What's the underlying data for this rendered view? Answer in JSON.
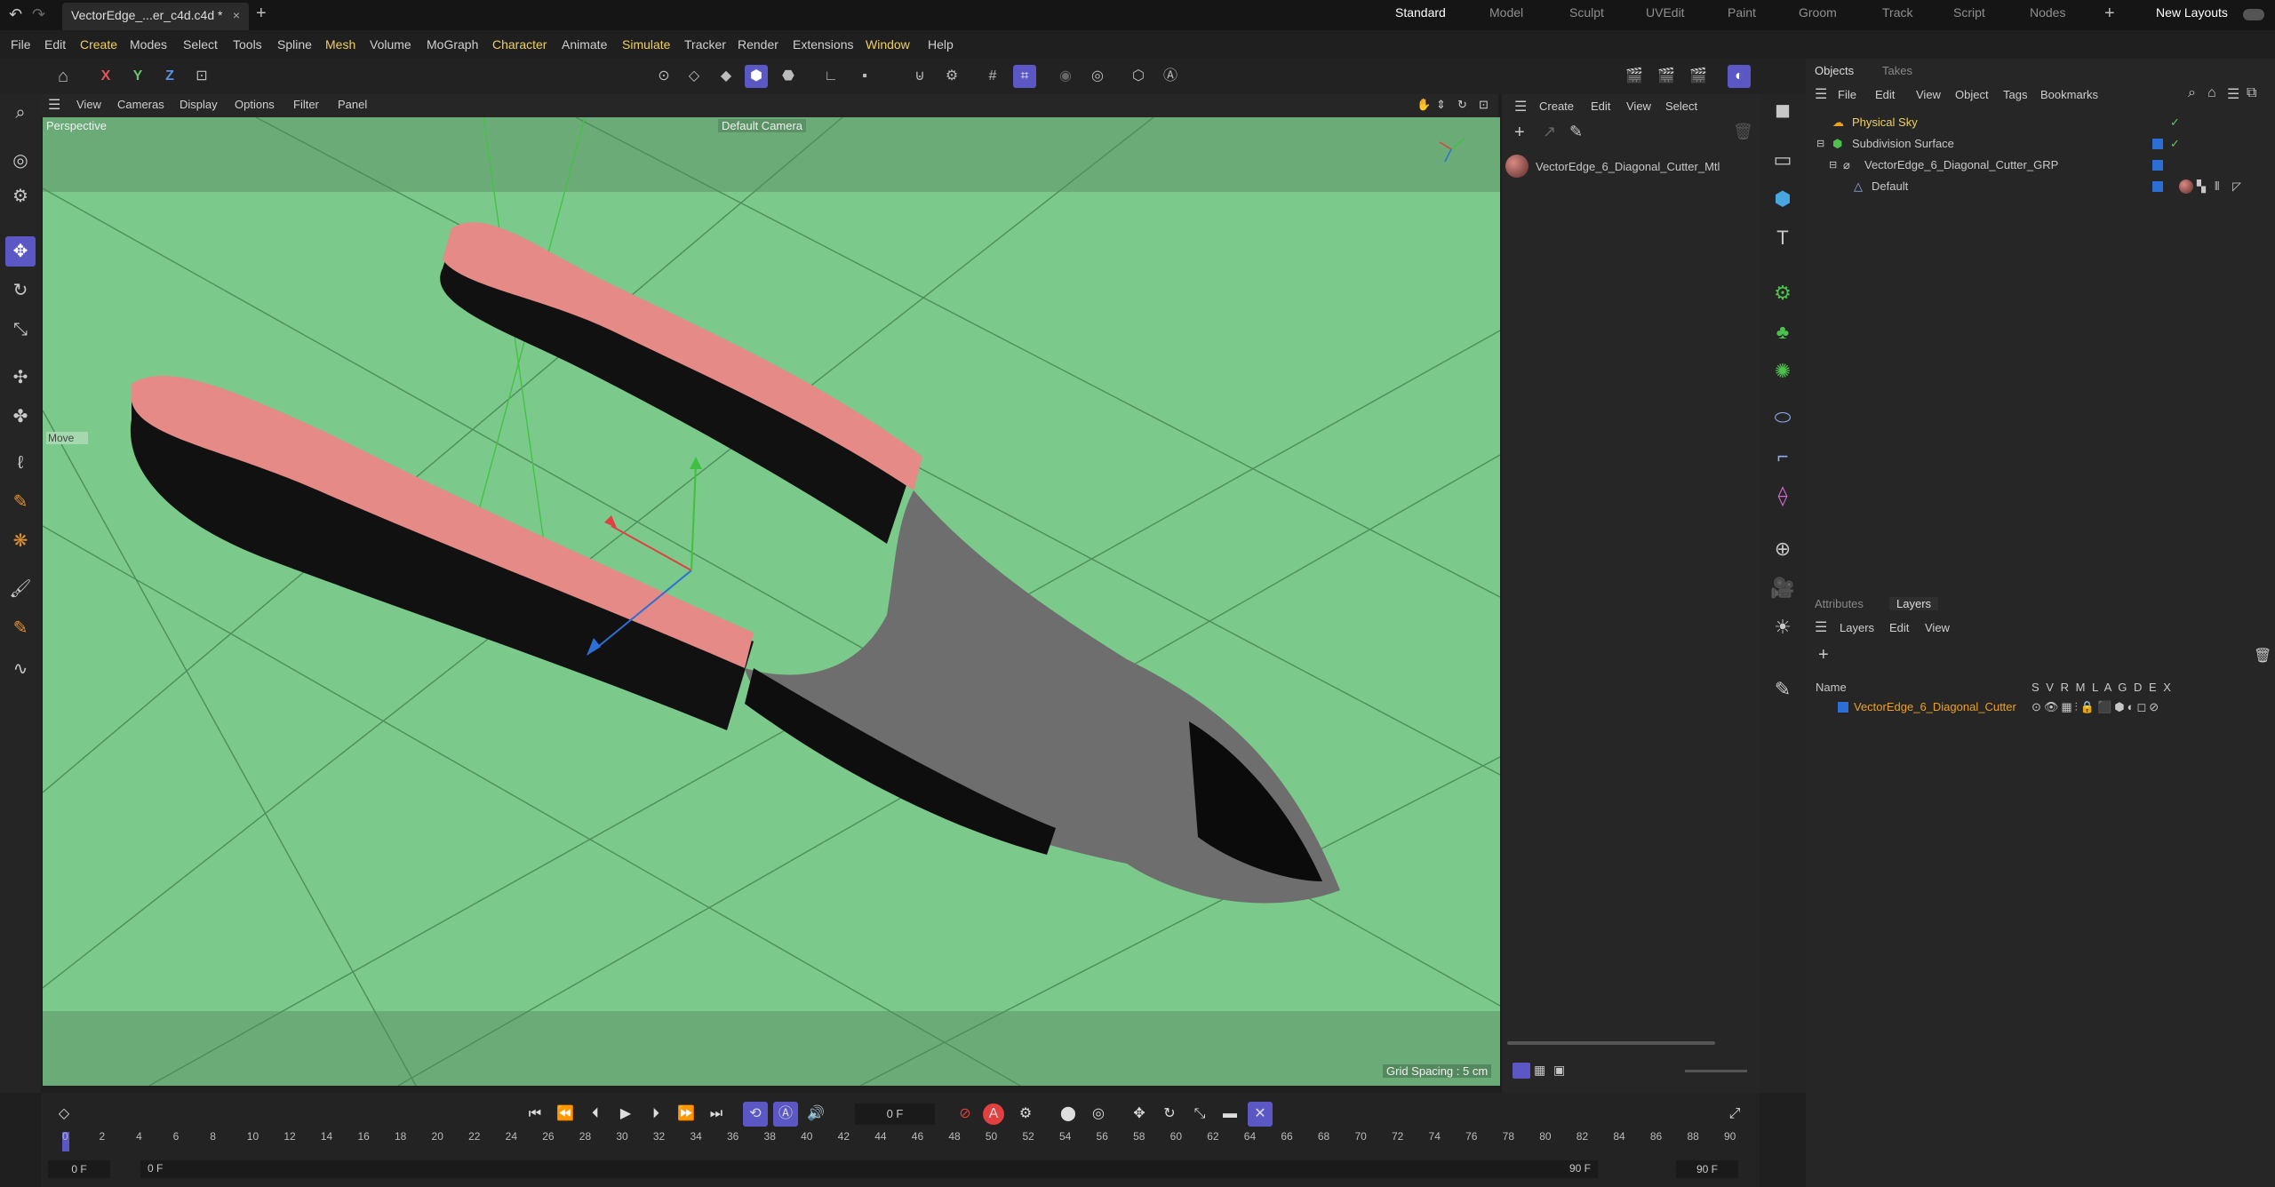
{
  "tab": {
    "title": "VectorEdge_...er_c4d.c4d *",
    "close": "×",
    "new": "+"
  },
  "layouts": [
    "Standard",
    "Model",
    "Sculpt",
    "UVEdit",
    "Paint",
    "Groom",
    "Track",
    "Script",
    "Nodes"
  ],
  "layouts_add": "+",
  "new_layouts": "New Layouts",
  "menu": [
    "File",
    "Edit",
    "Create",
    "Modes",
    "Select",
    "Tools",
    "Spline",
    "Mesh",
    "Volume",
    "MoGraph",
    "Character",
    "Animate",
    "Simulate",
    "Tracker",
    "Render",
    "Extensions",
    "Window",
    "Help"
  ],
  "axis": {
    "x": "X",
    "y": "Y",
    "z": "Z"
  },
  "viewport": {
    "menu": [
      "View",
      "Cameras",
      "Display",
      "Options",
      "Filter",
      "Panel"
    ],
    "label": "Perspective",
    "camera": "Default Camera",
    "move_hint": "Move",
    "grid_spacing": "Grid Spacing : 5 cm",
    "bg": "#7bc98b"
  },
  "material_panel": {
    "menu": [
      "Create",
      "Edit",
      "View",
      "Select"
    ],
    "materials": [
      {
        "name": "VectorEdge_6_Diagonal_Cutter_Mtl"
      }
    ]
  },
  "objects_panel": {
    "tabs": [
      "Objects",
      "Takes"
    ],
    "menu": [
      "File",
      "Edit",
      "View",
      "Object",
      "Tags",
      "Bookmarks"
    ],
    "items": [
      {
        "name": "Physical Sky",
        "color": "#f0d060"
      },
      {
        "name": "Subdivision Surface",
        "color": "#cfcfcf"
      },
      {
        "name": "VectorEdge_6_Diagonal_Cutter_GRP",
        "color": "#cfcfcf"
      },
      {
        "name": "Default",
        "color": "#cfcfcf"
      }
    ]
  },
  "layers_panel": {
    "tabs": [
      "Attributes",
      "Layers"
    ],
    "menu": [
      "Layers",
      "Edit",
      "View"
    ],
    "header_name": "Name",
    "header_flags": "S V R M L A G D E X",
    "layers": [
      {
        "name": "VectorEdge_6_Diagonal_Cutter",
        "color": "#f0a020"
      }
    ]
  },
  "timeline": {
    "current_frame": "0 F",
    "ticks": [
      "0",
      "2",
      "4",
      "6",
      "8",
      "10",
      "12",
      "14",
      "16",
      "18",
      "20",
      "22",
      "24",
      "26",
      "28",
      "30",
      "32",
      "34",
      "36",
      "38",
      "40",
      "42",
      "44",
      "46",
      "48",
      "50",
      "52",
      "54",
      "56",
      "58",
      "60",
      "62",
      "64",
      "66",
      "68",
      "70",
      "72",
      "74",
      "76",
      "78",
      "80",
      "82",
      "84",
      "86",
      "88",
      "90"
    ],
    "start": "0 F",
    "start2": "0 F",
    "end": "90 F",
    "end2": "90 F"
  },
  "colors": {
    "accent": "#5b57c4",
    "handle": "#e58a86",
    "metal": "#6e6e6e"
  }
}
